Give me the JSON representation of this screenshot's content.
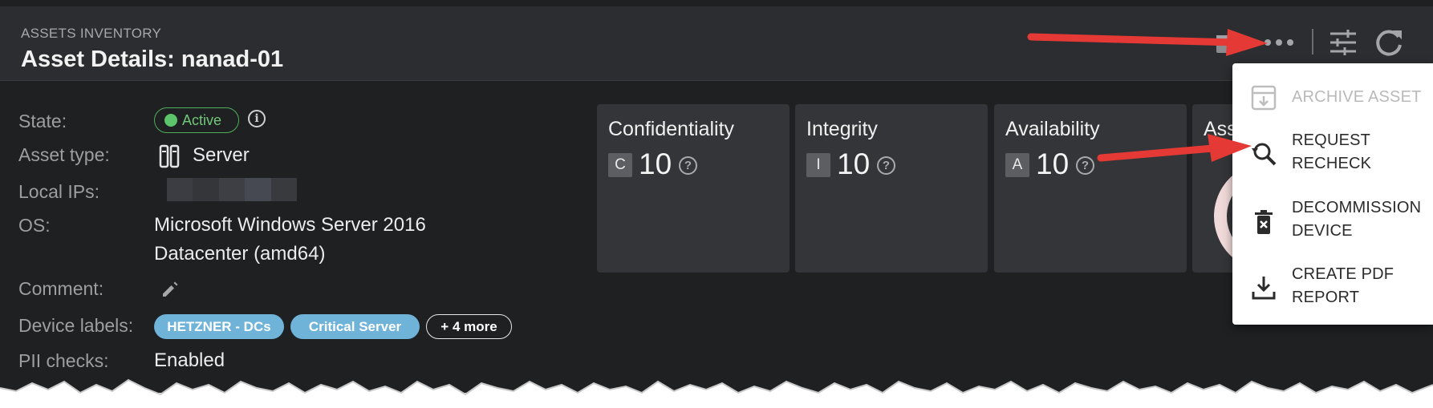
{
  "header": {
    "section": "ASSETS INVENTORY",
    "title": "Asset Details: nanad-01",
    "icons": [
      "calendar-icon",
      "more-icon",
      "filters-icon",
      "refresh-icon"
    ]
  },
  "details": {
    "state": {
      "label": "State:",
      "value": "Active",
      "color": "#5cc46a"
    },
    "asset_type": {
      "label": "Asset type:",
      "value": "Server",
      "icon": "server-icon"
    },
    "local_ips": {
      "label": "Local IPs:",
      "value_note": "redacted"
    },
    "os": {
      "label": "OS:",
      "value_line1": "Microsoft Windows Server 2016",
      "value_line2": "Datacenter (amd64)"
    },
    "comment": {
      "label": "Comment:",
      "icon": "edit-pencil-icon"
    },
    "device_labels": {
      "label": "Device labels:",
      "tags": [
        "HETZNER - DCs",
        "Critical Server"
      ],
      "more": "+ 4 more",
      "tag_color": "#6fb3d9"
    },
    "pii_checks": {
      "label": "PII checks:",
      "value": "Enabled"
    }
  },
  "cards": [
    {
      "name": "Confidentiality",
      "letter": "C",
      "score": "10"
    },
    {
      "name": "Integrity",
      "letter": "I",
      "score": "10"
    },
    {
      "name": "Availability",
      "letter": "A",
      "score": "10"
    },
    {
      "name": "Ass"
    }
  ],
  "menu": {
    "items": [
      {
        "line1": "ARCHIVE ASSET",
        "line2": "",
        "icon": "archive-icon",
        "disabled": true
      },
      {
        "line1": "REQUEST",
        "line2": "RECHECK",
        "icon": "search-refresh-icon",
        "disabled": false
      },
      {
        "line1": "DECOMMISSION",
        "line2": "DEVICE",
        "icon": "delete-icon",
        "disabled": false
      },
      {
        "line1": "CREATE PDF",
        "line2": "REPORT",
        "icon": "download-icon",
        "disabled": false
      }
    ]
  },
  "colors": {
    "background": "#1f2022",
    "header": "#2c2d30",
    "card": "#343538",
    "annotation_arrow": "#e53935"
  }
}
